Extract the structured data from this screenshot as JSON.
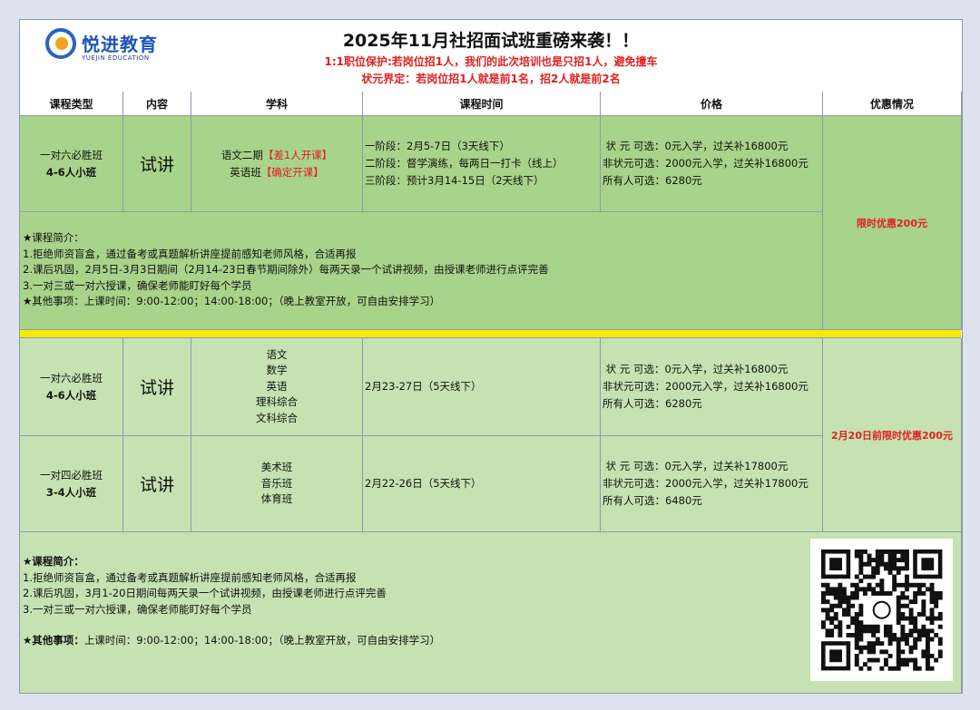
{
  "header": {
    "logo_cn": "悦进教育",
    "logo_en": "YUEJIN EDUCATION",
    "title": "2025年11月社招面试班重磅来袭！！",
    "sub1": "1:1职位保护:若岗位招1人，我们的此次培训也是只招1人，避免撞车",
    "sub2": "状元界定：若岗位招1人就是前1名，招2人就是前2名"
  },
  "columns": [
    "课程类型",
    "内容",
    "学科",
    "课程时间",
    "价格",
    "优惠情况"
  ],
  "section1": {
    "type1": "一对六必胜班",
    "type2": "4-6人小班",
    "content": "试讲",
    "subj1": "语文二期",
    "subj1_tag": "【差1人开课】",
    "subj2": "英语班",
    "subj2_tag": "【确定开课】",
    "time": [
      "一阶段：2月5-7日（3天线下）",
      "二阶段：督学演练，每两日一打卡（线上）",
      "三阶段：预计3月14-15日（2天线下）"
    ],
    "price": [
      " 状 元 可选：0元入学，过关补16800元",
      "非状元可选：2000元入学，过关补16800元",
      "所有人可选：6280元"
    ],
    "promo": "限时优惠200元",
    "intro": [
      "★课程简介：",
      "1.拒绝师资盲盒，通过备考或真题解析讲座提前感知老师风格，合适再报",
      "2.课后巩固，2月5日-3月3日期间（2月14-23日春节期间除外）每两天录一个试讲视频，由授课老师进行点评完善",
      "3.一对三或一对六授课，确保老师能盯好每个学员",
      "★其他事项：上课时间：9:00-12:00；14:00-18:00；（晚上教室开放，可自由安排学习）"
    ]
  },
  "section2": {
    "row1": {
      "type1": "一对六必胜班",
      "type2": "4-6人小班",
      "content": "试讲",
      "subjects": [
        "语文",
        "数学",
        "英语",
        "理科综合",
        "文科综合"
      ],
      "time": "2月23-27日（5天线下）",
      "price": [
        " 状 元 可选：0元入学，过关补16800元",
        "非状元可选：2000元入学，过关补16800元",
        "所有人可选：6280元"
      ]
    },
    "row2": {
      "type1": "一对四必胜班",
      "type2": "3-4人小班",
      "content": "试讲",
      "subjects": [
        "美术班",
        "音乐班",
        "体育班"
      ],
      "time": "2月22-26日（5天线下）",
      "price": [
        " 状 元 可选：0元入学，过关补17800元",
        "非状元可选：2000元入学，过关补17800元",
        "所有人可选：6480元"
      ]
    },
    "promo": "2月20日前限时优惠200元",
    "intro_title": "★课程简介：",
    "intro": [
      "1.拒绝师资盲盒，通过备考或真题解析讲座提前感知老师风格，合适再报",
      "2.课后巩固，3月1-20日期间每两天录一个试讲视频，由授课老师进行点评完善",
      "3.一对三或一对六授课，确保老师能盯好每个学员"
    ],
    "other_title": "★其他事项：",
    "other": "上课时间：9:00-12:00；14:00-18:00；（晚上教室开放，可自由安排学习）"
  }
}
